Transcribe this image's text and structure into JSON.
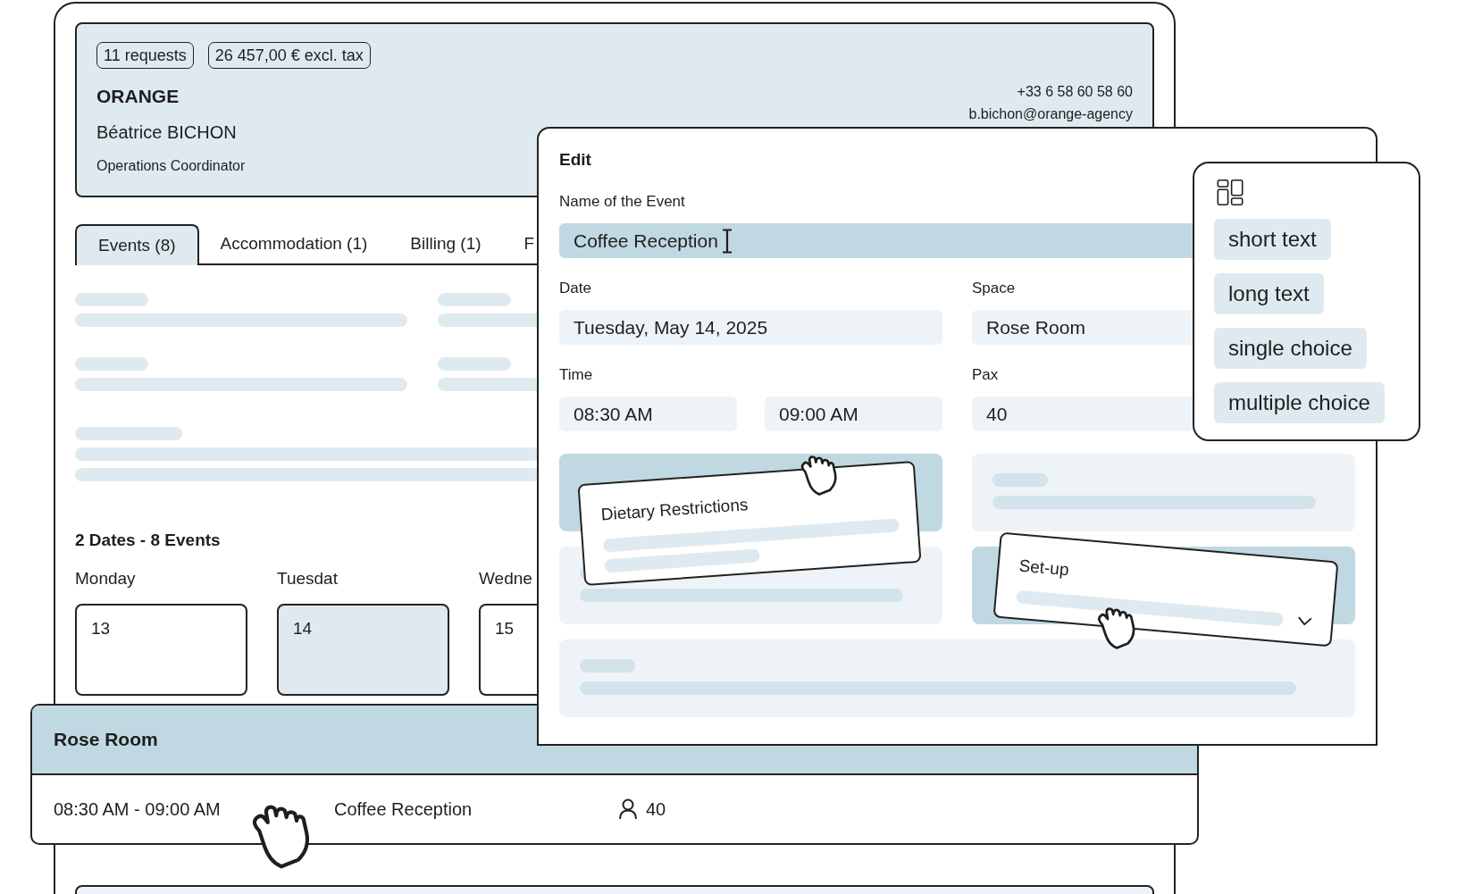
{
  "summary": {
    "badges": [
      "11 requests",
      "26 457,00 € excl. tax"
    ],
    "company": "ORANGE",
    "contact_name": "Béatrice BICHON",
    "role": "Operations Coordinator",
    "phone": "+33 6 58 60 58 60",
    "email": "b.bichon@orange-agency"
  },
  "tabs": [
    {
      "label": "Events (8)",
      "selected": true
    },
    {
      "label": "Accommodation (1)",
      "selected": false
    },
    {
      "label": "Billing (1)",
      "selected": false
    },
    {
      "label": "F",
      "selected": false
    }
  ],
  "calendar": {
    "title": "2 Dates - 8 Events",
    "days": [
      {
        "weekday": "Monday",
        "date": "13",
        "selected": false
      },
      {
        "weekday": "Tuesdat",
        "date": "14",
        "selected": true
      },
      {
        "weekday": "Wedne",
        "date": "15",
        "selected": false
      }
    ]
  },
  "space_panel": {
    "title": "Rose Room",
    "event": {
      "time": "08:30 AM - 09:00 AM",
      "name": "Coffee Reception",
      "pax": "40"
    }
  },
  "edit_dialog": {
    "title": "Edit",
    "name_field": {
      "label": "Name of the Event",
      "value": "Coffee Reception",
      "focused": true
    },
    "date_field": {
      "label": "Date",
      "value": "Tuesday, May 14, 2025"
    },
    "space_field": {
      "label": "Space",
      "value": "Rose Room"
    },
    "time_field": {
      "label": "Time",
      "start": "08:30 AM",
      "end": "09:00 AM"
    },
    "pax_field": {
      "label": "Pax",
      "value": "40"
    },
    "drop_zones": [
      {
        "highlighted": true
      },
      {
        "highlighted": false
      },
      {
        "highlighted": false
      },
      {
        "highlighted": true
      },
      {
        "highlighted": false
      }
    ],
    "dragged_cards": [
      {
        "title": "Dietary Restrictions",
        "kind": "text"
      },
      {
        "title": "Set-up",
        "kind": "select"
      }
    ]
  },
  "field_types": [
    "short text",
    "long text",
    "single choice",
    "multiple choice"
  ]
}
